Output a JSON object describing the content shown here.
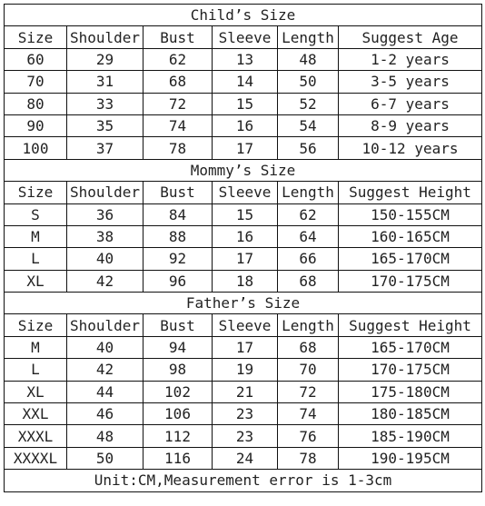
{
  "sections": [
    {
      "title": "Child’s Size",
      "headers": [
        "Size",
        "Shoulder",
        "Bust",
        "Sleeve",
        "Length",
        "Suggest Age"
      ],
      "rows": [
        [
          "60",
          "29",
          "62",
          "13",
          "48",
          "1-2 years"
        ],
        [
          "70",
          "31",
          "68",
          "14",
          "50",
          "3-5 years"
        ],
        [
          "80",
          "33",
          "72",
          "15",
          "52",
          "6-7 years"
        ],
        [
          "90",
          "35",
          "74",
          "16",
          "54",
          "8-9 years"
        ],
        [
          "100",
          "37",
          "78",
          "17",
          "56",
          "10-12 years"
        ]
      ]
    },
    {
      "title": "Mommy’s Size",
      "headers": [
        "Size",
        "Shoulder",
        "Bust",
        "Sleeve",
        "Length",
        "Suggest Height"
      ],
      "rows": [
        [
          "S",
          "36",
          "84",
          "15",
          "62",
          "150-155CM"
        ],
        [
          "M",
          "38",
          "88",
          "16",
          "64",
          "160-165CM"
        ],
        [
          "L",
          "40",
          "92",
          "17",
          "66",
          "165-170CM"
        ],
        [
          "XL",
          "42",
          "96",
          "18",
          "68",
          "170-175CM"
        ]
      ]
    },
    {
      "title": "Father’s Size",
      "headers": [
        "Size",
        "Shoulder",
        "Bust",
        "Sleeve",
        "Length",
        "Suggest Height"
      ],
      "rows": [
        [
          "M",
          "40",
          "94",
          "17",
          "68",
          "165-170CM"
        ],
        [
          "L",
          "42",
          "98",
          "19",
          "70",
          "170-175CM"
        ],
        [
          "XL",
          "44",
          "102",
          "21",
          "72",
          "175-180CM"
        ],
        [
          "XXL",
          "46",
          "106",
          "23",
          "74",
          "180-185CM"
        ],
        [
          "XXXL",
          "48",
          "112",
          "23",
          "76",
          "185-190CM"
        ],
        [
          "XXXXL",
          "50",
          "116",
          "24",
          "78",
          "190-195CM"
        ]
      ]
    }
  ],
  "footer": "Unit:CM,Measurement error is 1-3cm"
}
